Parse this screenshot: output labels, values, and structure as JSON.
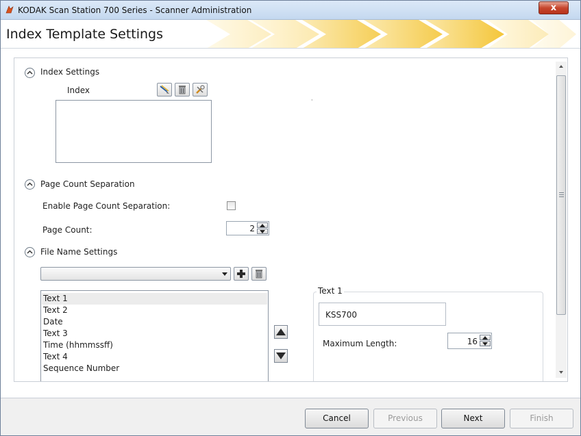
{
  "window": {
    "title": "KODAK Scan Station 700 Series - Scanner Administration",
    "close_label": "x"
  },
  "header": {
    "title": "Index Template Settings"
  },
  "index_settings": {
    "section_label": "Index Settings",
    "list_label": "Index",
    "items": []
  },
  "page_count_separation": {
    "section_label": "Page Count Separation",
    "enable_label": "Enable Page Count Separation:",
    "enabled": false,
    "page_count_label": "Page Count:",
    "page_count_value": "2"
  },
  "file_name_settings": {
    "section_label": "File Name Settings",
    "combo_value": "",
    "items": [
      {
        "label": "Text 1",
        "selected": true
      },
      {
        "label": "Text 2",
        "selected": false
      },
      {
        "label": "Date",
        "selected": false
      },
      {
        "label": "Text 3",
        "selected": false
      },
      {
        "label": "Time (hhmmssff)",
        "selected": false
      },
      {
        "label": "Text 4",
        "selected": false
      },
      {
        "label": "Sequence Number",
        "selected": false
      }
    ],
    "detail": {
      "group_title": "Text 1",
      "text_value": "KSS700",
      "max_length_label": "Maximum Length:",
      "max_length_value": "16"
    }
  },
  "footer": {
    "cancel_label": "Cancel",
    "previous_label": "Previous",
    "next_label": "Next",
    "finish_label": "Finish"
  },
  "colors": {
    "title_bar": "#c4d8ef",
    "close_button": "#c7472e",
    "header_chevrons": "#f7c842",
    "footer_bg": "#f0f0f0"
  }
}
